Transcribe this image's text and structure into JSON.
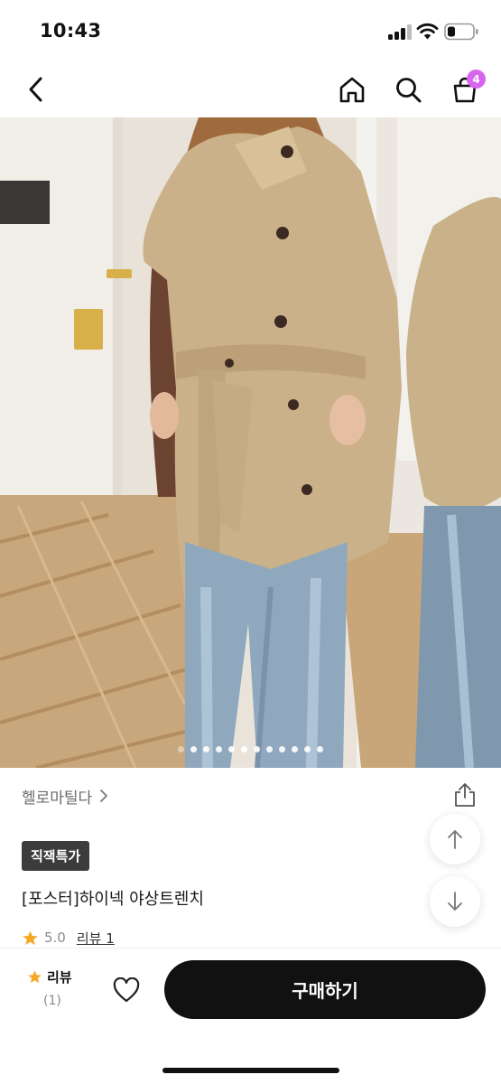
{
  "status_bar": {
    "time": "10:43"
  },
  "header": {
    "cart_count": "4"
  },
  "gallery": {
    "total_images": 12,
    "active_index": 0
  },
  "product": {
    "brand": "헬로마틸다",
    "tag": "직잭특가",
    "title": "[포스터]하이넥 야상트렌치",
    "rating": "5.0",
    "review_link": "리뷰 1"
  },
  "bottom_bar": {
    "review_label": "리뷰",
    "review_count": "(1)",
    "buy_label": "구매하기"
  },
  "colors": {
    "accent": "#d864f0",
    "star": "#f5a623",
    "buy_button": "#111111"
  },
  "icons": [
    "back-icon",
    "home-icon",
    "search-icon",
    "cart-icon",
    "share-icon",
    "arrow-up-icon",
    "arrow-down-icon",
    "star-icon",
    "heart-icon"
  ]
}
